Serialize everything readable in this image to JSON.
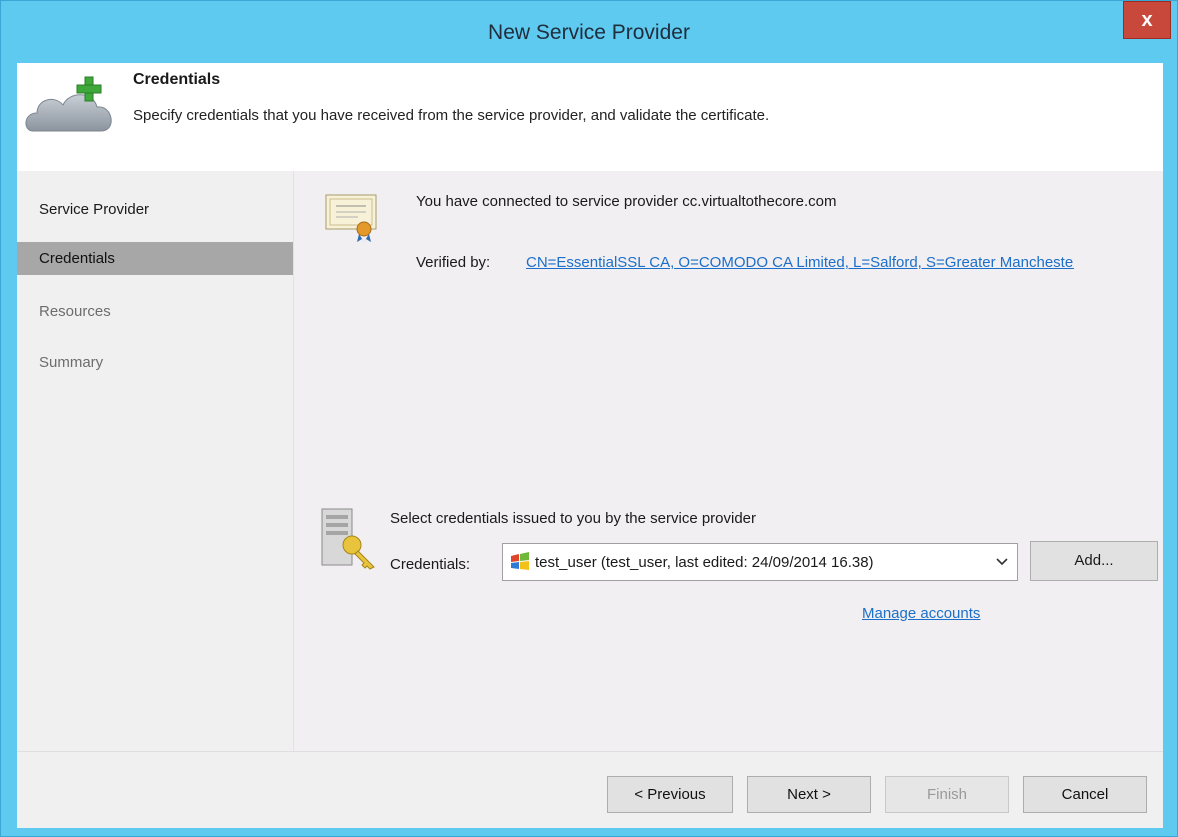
{
  "window": {
    "title": "New Service Provider",
    "close_label": "x"
  },
  "header": {
    "title": "Credentials",
    "description": "Specify credentials that you have received from the service provider, and validate the certificate.",
    "icon": "cloud-add-icon"
  },
  "sidebar": {
    "items": [
      {
        "label": "Service Provider",
        "state": "normal"
      },
      {
        "label": "Credentials",
        "state": "active"
      },
      {
        "label": "Resources",
        "state": "disabled"
      },
      {
        "label": "Summary",
        "state": "disabled"
      }
    ]
  },
  "main": {
    "connected_text": "You have connected to service provider cc.virtualtothecore.com",
    "verified_label": "Verified by:",
    "verified_link": "CN=EssentialSSL CA, O=COMODO CA Limited, L=Salford, S=Greater Manchester, C=GB",
    "select_text": "Select credentials issued to you by the service provider",
    "credentials_label": "Credentials:",
    "credentials_value": "test_user (test_user, last edited: 24/09/2014 16.38)",
    "add_label": "Add...",
    "manage_link": "Manage accounts"
  },
  "footer": {
    "previous_label": "< Previous",
    "next_label": "Next >",
    "finish_label": "Finish",
    "cancel_label": "Cancel"
  },
  "colors": {
    "title_bar": "#5fcaf0",
    "link": "#1c6fc9",
    "active_nav": "#a7a7a7",
    "close": "#c9483c"
  }
}
